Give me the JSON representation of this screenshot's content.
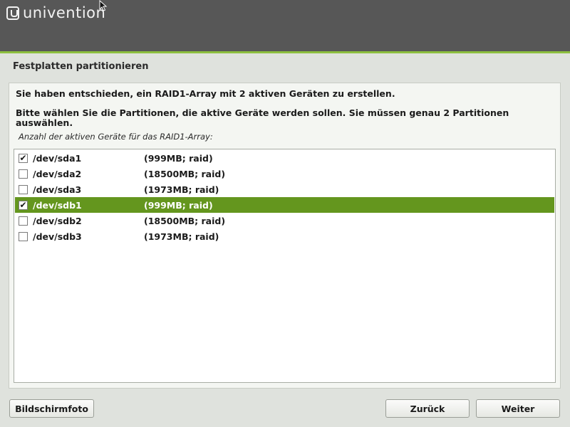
{
  "header": {
    "logo_text": "univention"
  },
  "page": {
    "title": "Festplatten partitionieren",
    "message1": "Sie haben entschieden, ein RAID1-Array mit 2 aktiven Geräten zu erstellen.",
    "message2": "Bitte wählen Sie die Partitionen, die aktive Geräte werden sollen. Sie müssen genau 2 Partitionen auswählen.",
    "list_label": "Anzahl der aktiven Geräte für das RAID1-Array:"
  },
  "devices": [
    {
      "name": "/dev/sda1",
      "info": "(999MB; raid)",
      "checked": true,
      "selected": false
    },
    {
      "name": "/dev/sda2",
      "info": "(18500MB; raid)",
      "checked": false,
      "selected": false
    },
    {
      "name": "/dev/sda3",
      "info": "(1973MB; raid)",
      "checked": false,
      "selected": false
    },
    {
      "name": "/dev/sdb1",
      "info": "(999MB; raid)",
      "checked": true,
      "selected": true
    },
    {
      "name": "/dev/sdb2",
      "info": "(18500MB; raid)",
      "checked": false,
      "selected": false
    },
    {
      "name": "/dev/sdb3",
      "info": "(1973MB; raid)",
      "checked": false,
      "selected": false
    }
  ],
  "buttons": {
    "screenshot": "Bildschirmfoto",
    "back": "Zurück",
    "next": "Weiter"
  },
  "colors": {
    "header_bg": "#575757",
    "accent": "#8cbf3f",
    "selection": "#64961e"
  }
}
